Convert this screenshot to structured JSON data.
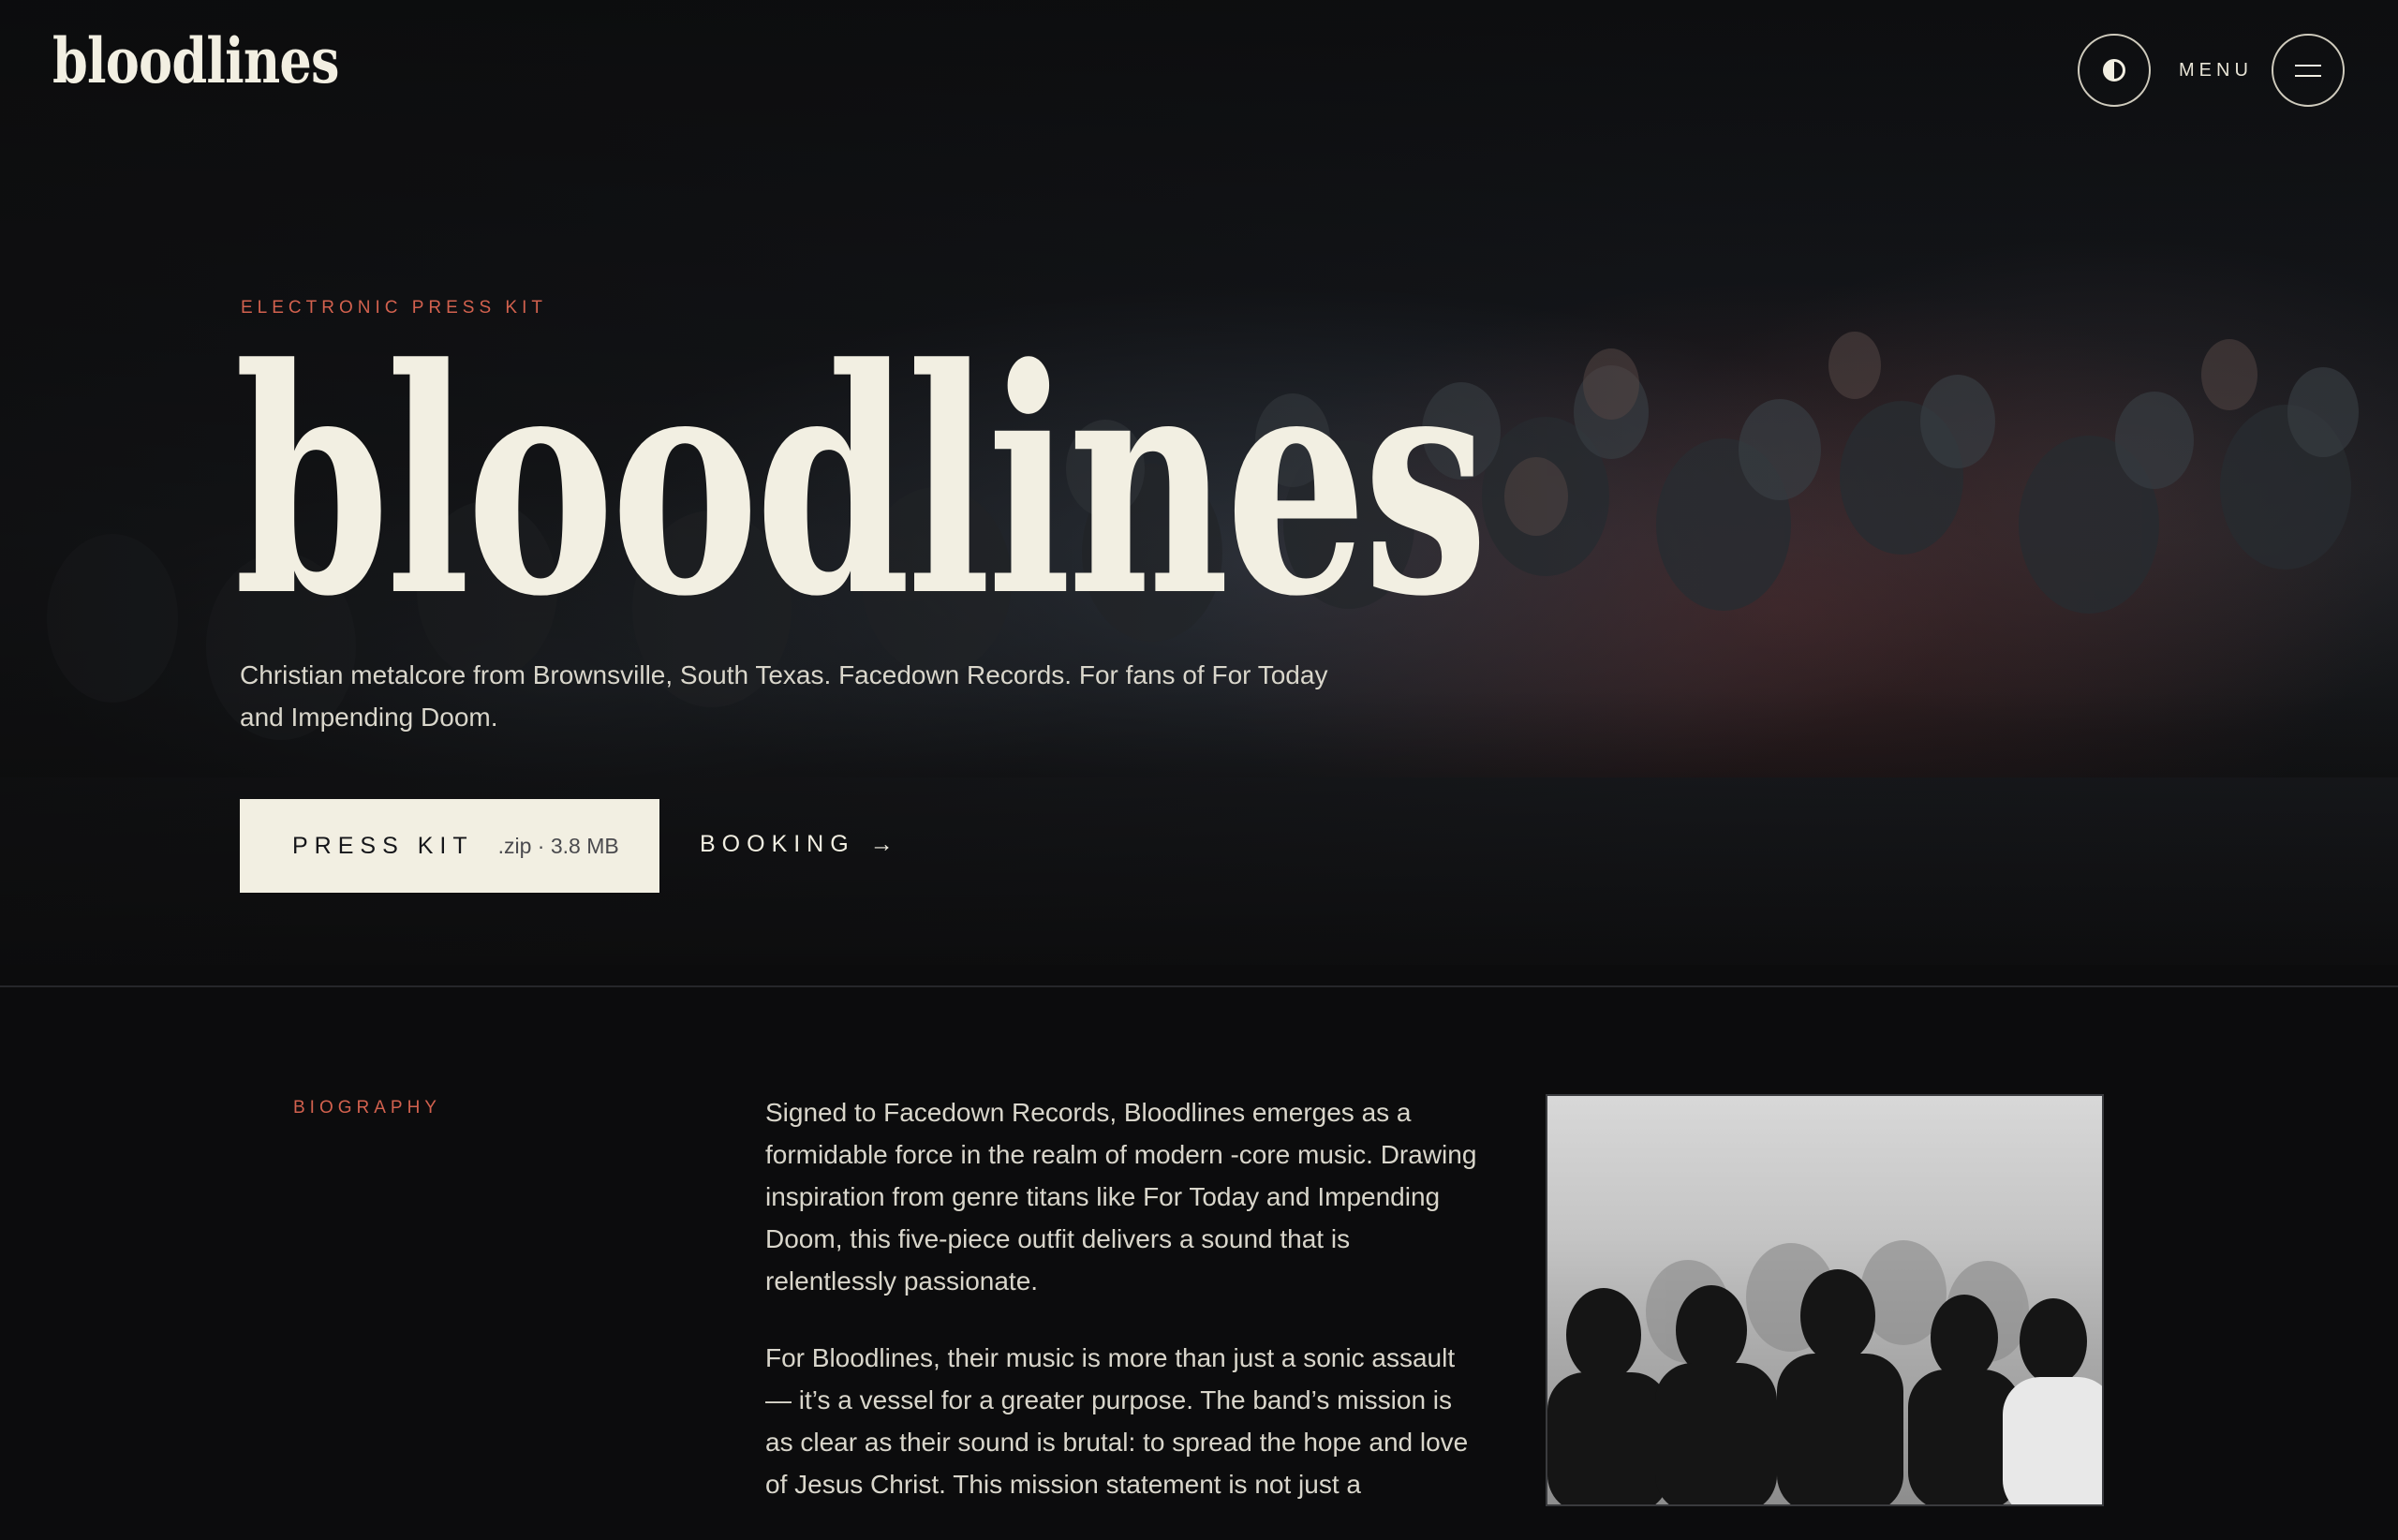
{
  "header": {
    "logo": "bloodlines",
    "menu_label": "MENU",
    "theme_icon": "contrast-icon",
    "menu_icon": "hamburger-icon"
  },
  "hero": {
    "eyebrow": "ELECTRONIC PRESS KIT",
    "title": "bloodlines",
    "description": "Christian metalcore from Brownsville, South Texas. Facedown Records. For fans of For Today and Impending Doom.",
    "press_kit_label": "PRESS KIT",
    "press_kit_meta": ".zip · 3.8 MB",
    "booking_label": "BOOKING",
    "booking_arrow": "→"
  },
  "biography": {
    "eyebrow": "BIOGRAPHY",
    "paragraphs": [
      "Signed to Facedown Records, Bloodlines emerges as a formidable force in the realm of modern -core music. Drawing inspiration from genre titans like For Today and Impending Doom, this five-piece outfit delivers a sound that is relentlessly passionate.",
      "For Bloodlines, their music is more than just a sonic assault — it’s a vessel for a greater purpose. The band’s mission is as clear as their sound is brutal: to spread the hope and love of Jesus Christ. This mission statement is not just a"
    ]
  },
  "colors": {
    "accent": "#d2614e",
    "cream": "#f2efe2",
    "background": "#0c0c0d"
  }
}
